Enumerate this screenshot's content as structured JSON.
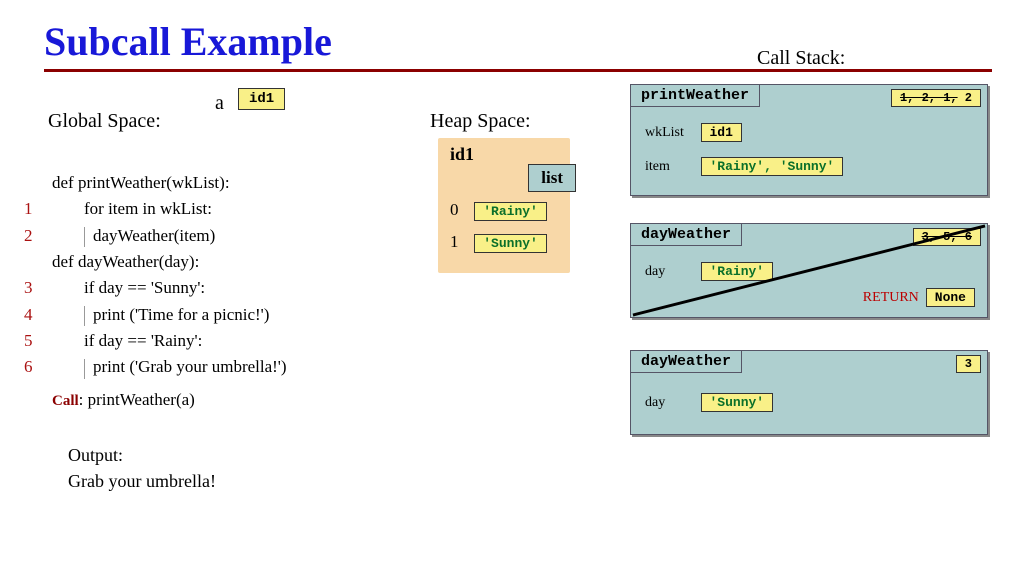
{
  "title": "Subcall Example",
  "global_space_label": "Global Space:",
  "a_label": "a",
  "a_value": "id1",
  "heap_label": "Heap Space:",
  "callstack_label": "Call Stack:",
  "heap": {
    "id_label": "id1",
    "type": "list",
    "items": [
      {
        "index": "0",
        "value": "'Rainy'"
      },
      {
        "index": "1",
        "value": "'Sunny'"
      }
    ]
  },
  "code": {
    "l0": "def printWeather(wkList):",
    "l1": "for item in wkList:",
    "l2": "dayWeather(item)",
    "l3": "def dayWeather(day):",
    "l4": "if day == 'Sunny':",
    "l5": "print ('Time for a picnic!')",
    "l6": "if day == 'Rainy':",
    "l7": "print ('Grab your umbrella!')",
    "call_prefix": "Call",
    "call": ": printWeather(a)",
    "ln1": "1",
    "ln2": "2",
    "ln3": "3",
    "ln4": "4",
    "ln5": "5",
    "ln6": "6"
  },
  "output_label": "Output:",
  "output_value": "Grab your umbrella!",
  "frames": {
    "f1": {
      "name": "printWeather",
      "lines_struck": "1, 2, 1,",
      "lines_current": " 2",
      "vars": {
        "wkList_name": "wkList",
        "wkList_val": "id1",
        "item_name": "item",
        "item_val": "'Rainy',  'Sunny'"
      }
    },
    "f2": {
      "name": "dayWeather",
      "lines": "3, 5, 6",
      "vars": {
        "day_name": "day",
        "day_val": "'Rainy'"
      },
      "return_label": "RETURN",
      "return_val": "None"
    },
    "f3": {
      "name": "dayWeather",
      "lines": "3",
      "vars": {
        "day_name": "day",
        "day_val": "'Sunny'"
      }
    }
  }
}
